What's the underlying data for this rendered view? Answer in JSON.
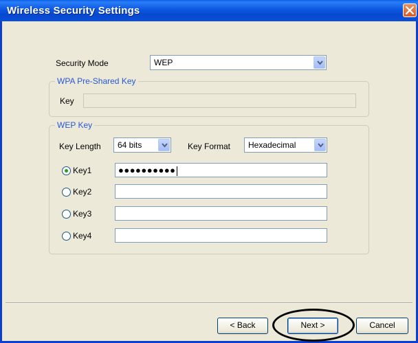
{
  "window": {
    "title": "Wireless Security Settings"
  },
  "security_mode": {
    "label": "Security Mode",
    "value": "WEP"
  },
  "wpa_group": {
    "legend": "WPA Pre-Shared Key",
    "key_label": "Key",
    "key_value": ""
  },
  "wep_group": {
    "legend": "WEP Key",
    "key_length_label": "Key Length",
    "key_length_value": "64 bits",
    "key_format_label": "Key Format",
    "key_format_value": "Hexadecimal",
    "keys": [
      {
        "label": "Key1",
        "selected": true,
        "value": "●●●●●●●●●●"
      },
      {
        "label": "Key2",
        "selected": false,
        "value": ""
      },
      {
        "label": "Key3",
        "selected": false,
        "value": ""
      },
      {
        "label": "Key4",
        "selected": false,
        "value": ""
      }
    ]
  },
  "buttons": {
    "back": "< Back",
    "next": "Next >",
    "cancel": "Cancel"
  },
  "icons": {
    "close": "close-icon",
    "dropdown": "chevron-down-icon"
  },
  "colors": {
    "titlebar": "#0a4fd8",
    "legend": "#2757d6",
    "close": "#d85a2a",
    "radio_selected": "#21a121"
  }
}
